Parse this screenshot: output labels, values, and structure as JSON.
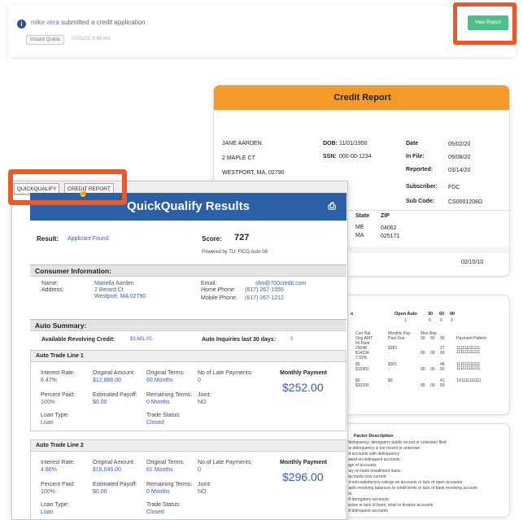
{
  "notification": {
    "user": "mike vera",
    "message": "submitted a credit application",
    "chip": "Instant Quiirie",
    "time": "07/01/21 9:49 AM",
    "view_button": "View Report"
  },
  "credit_report": {
    "title": "Credit Report",
    "consumer_name": "JANE AARDEN",
    "address1": "2 MAPLE CT",
    "address2": "WESTPORT, MA, 02790",
    "dob_label": "DOB:",
    "dob": "11/01/1950",
    "ssn_label": "SSN:",
    "ssn": "000-00-1234",
    "date_label": "Date",
    "date": "05/02/20",
    "infile_label": "In File:",
    "infile": "09/08/20",
    "reported_label": "Reported:",
    "reported": "03/14/20",
    "subscriber_label": "Subscriber:",
    "subscriber": "FDC",
    "subcode_label": "Sub Code:",
    "subcode": "CS0001208G",
    "state_header": "State",
    "zip_header": "ZIP",
    "state1": "ME",
    "zip1": "04062",
    "state2": "MA",
    "zip2": "025171",
    "bottom_date": "02/15/10"
  },
  "report2": {
    "col_o": "o",
    "col_open_auto": "Open Auto",
    "col_30": "30",
    "col_60": "60",
    "col_90": "90",
    "open_auto_val": "1",
    "v30": "0",
    "v60": "0",
    "v90": "0",
    "h_curr_bal": "Curr Bal",
    "h_orig_amt": "Orig AMT",
    "h_int_rate": "Int Rate",
    "h_monthly_pay": "Monthly Pay",
    "h_past_due": "Past Due",
    "h_mos_rep": "Mos Rep",
    "h_30": "30",
    "h_60": "60",
    "h_90": "90",
    "h_payment_pattern": "Payment Pattern",
    "rows": [
      {
        "a": "29048",
        "b": "$14234",
        "c": "7.02%",
        "pay": "$282",
        "pd": "-",
        "mos": "27",
        "x30": "00",
        "x60": "00",
        "x90": "00",
        "pat": "111111111111"
      },
      {
        "a": "$0",
        "b": "$15952",
        "c": "",
        "pay": "$301",
        "pd": "-",
        "mos": "48",
        "x30": "00",
        "x60": "00",
        "x90": "00",
        "pat": "111111111111"
      },
      {
        "a": "$0",
        "b": "$10205",
        "c": "",
        "pay": "$0",
        "pd": "-",
        "mos": "41",
        "x30": "00",
        "x60": "00",
        "x90": "00",
        "pat": "1X1111111111"
      }
    ]
  },
  "report3": {
    "title": "Factor Description",
    "lines": [
      "delinquency, derogatory public record or collection filed",
      "ce delinquency is too recent or unknown",
      "of accounts with delinquency",
      "owed on delinquent accounts",
      "age of accounts",
      "ncy on bank installment loans",
      "accounts now current",
      "of non-satisfactory ratings on accounts or lack of open accounts",
      "bank revolving balances to credit limits or lack of bank revolving account",
      "on",
      "of derogatory accounts",
      "active or lack of bank, retail or finance accounts",
      "of delinquent accounts"
    ]
  },
  "quickqualify": {
    "tab1": "QUICKQUALIFY",
    "tab2": "CREDIT REPORT",
    "title": "QuickQualify Results",
    "result_label": "Result:",
    "result_value": "Applicant Found",
    "score_label": "Score:",
    "score_value": "727",
    "powered_by": "Powered by TU: FICO Auto 08",
    "consumer_section": "Consumer Information:",
    "name_label": "Name:",
    "name_value": "Mariella Aarden",
    "address_label": "Address:",
    "address1": "2 Berard Ct",
    "address2": "Westport, MA 02790",
    "email_label": "Email:",
    "email_value": "sho@700credit.com",
    "home_phone_label": "Home Phone:",
    "home_phone": "(617) 267-1555",
    "mobile_phone_label": "Mobile Phone:",
    "mobile_phone": "(617) 267-1212",
    "auto_section": "Auto Summary:",
    "avail_rev_label": "Available Revolving Credit:",
    "avail_rev_value": "$3,681.00",
    "auto_inq_label": "Auto Inquiries last 30 days:",
    "auto_inq_value": "0",
    "trade_lines": [
      {
        "title": "Auto Trade Line 1",
        "int_rate_label": "Interest Rate:",
        "int_rate": "6.47%",
        "orig_amt_label": "Original Amount:",
        "orig_amt": "$12,886.00",
        "orig_terms_label": "Original Terms:",
        "orig_terms": "60 Months",
        "late_label": "No of Late Payments:",
        "late": "0",
        "monthly_label": "Monthly Payment",
        "monthly": "$252.00",
        "pct_paid_label": "Percent Paid:",
        "pct_paid": "100%",
        "est_payoff_label": "Estimated Payoff:",
        "est_payoff": "$0.00",
        "rem_terms_label": "Remaining Terms:",
        "rem_terms": "0 Months",
        "joint_label": "Joint:",
        "joint": "NO",
        "loan_type_label": "Loan Type:",
        "loan_type": "Loan",
        "trade_status_label": "Trade Status:",
        "trade_status": "Closed"
      },
      {
        "title": "Auto Trade Line 2",
        "int_rate_label": "Interest Rate:",
        "int_rate": "4.86%",
        "orig_amt_label": "Original Amount:",
        "orig_amt": "$16,045.00",
        "orig_terms_label": "Original Terms:",
        "orig_terms": "61 Months",
        "late_label": "No of Late Payments:",
        "late": "0",
        "monthly_label": "Monthly Payment",
        "monthly": "$296.00",
        "pct_paid_label": "Percent Paid:",
        "pct_paid": "100%",
        "est_payoff_label": "Estimated Payoff:",
        "est_payoff": "$0.00",
        "rem_terms_label": "Remaining Terms:",
        "rem_terms": "0 Months",
        "joint_label": "Joint:",
        "joint": "NO",
        "loan_type_label": "Loan Type:",
        "loan_type": "Loan",
        "trade_status_label": "Trade Status:",
        "trade_status": "Closed"
      }
    ]
  },
  "colors": {
    "accent_orange": "#e85a2a",
    "report_header": "#f39a2b",
    "qq_blue": "#2b5fa8",
    "link_blue": "#3a5cb3",
    "button_green": "#4bc08a"
  }
}
